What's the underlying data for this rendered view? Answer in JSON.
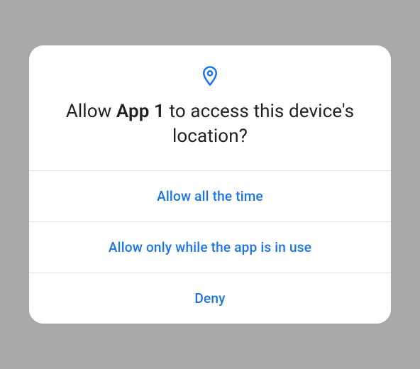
{
  "dialog": {
    "icon": "location-pin-icon",
    "accent_color": "#1a73e8",
    "title_prefix": "Allow ",
    "app_name": "App 1",
    "title_suffix": " to access this device's location?",
    "options": {
      "allow_all": "Allow all the time",
      "allow_in_use": "Allow only while the app is in use",
      "deny": "Deny"
    }
  }
}
